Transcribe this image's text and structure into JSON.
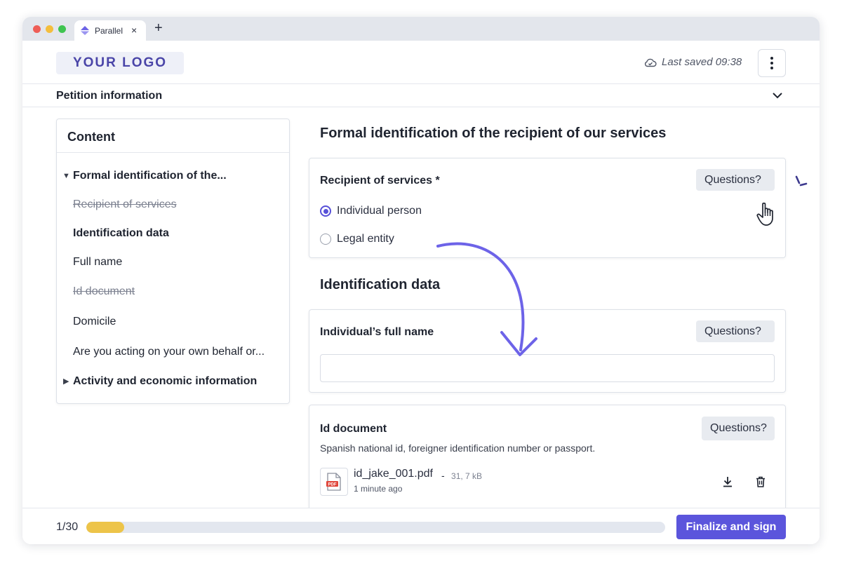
{
  "browser": {
    "tab_title": "Parallel",
    "tab_close": "×",
    "new_tab": "+"
  },
  "header": {
    "logo_text": "YOUR LOGO",
    "last_saved": "Last saved 09:38"
  },
  "petition": {
    "title": "Petition information"
  },
  "toc": {
    "heading": "Content",
    "items": [
      {
        "label": "Formal identification of the...",
        "style": "section-expanded"
      },
      {
        "label": "Recipient of services",
        "style": "completed"
      },
      {
        "label": "Identification data",
        "style": "current"
      },
      {
        "label": "Full name",
        "style": "normal"
      },
      {
        "label": "Id document",
        "style": "completed"
      },
      {
        "label": "Domicile",
        "style": "normal"
      },
      {
        "label": "Are you acting on your own behalf or...",
        "style": "normal"
      },
      {
        "label": "Activity and economic information",
        "style": "section-collapsed"
      }
    ]
  },
  "main": {
    "section1_title": "Formal identification of the recipient of our services",
    "recipient": {
      "label": "Recipient of services *",
      "questions_label": "Questions?",
      "options": [
        "Individual person",
        "Legal entity"
      ],
      "selected": "Individual person"
    },
    "section2_title": "Identification data",
    "full_name": {
      "label": "Individual’s full name",
      "questions_label": "Questions?",
      "value": ""
    },
    "id_document": {
      "label": "Id document",
      "questions_label": "Questions?",
      "hint": "Spanish national id, foreigner identification number or passport.",
      "file_name": "id_jake_001.pdf",
      "file_dash": "-",
      "file_size": "31, 7 kB",
      "file_time": "1 minute ago",
      "file_badge": "PDF"
    }
  },
  "footer": {
    "progress_label": "1/30",
    "progress_fraction": 0.065,
    "finalize_label": "Finalize and sign"
  },
  "colors": {
    "accent": "#5b55dc",
    "progress_fill": "#edc449",
    "logo_text": "#4a45a8",
    "pdf_red": "#e0453a"
  }
}
